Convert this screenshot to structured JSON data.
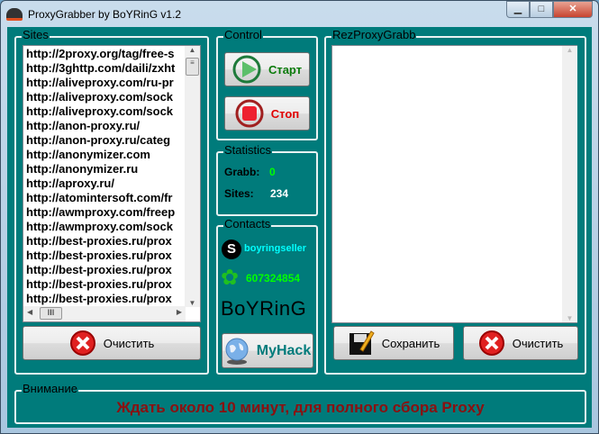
{
  "window": {
    "title": "ProxyGrabber by BoYRinG v1.2"
  },
  "sites": {
    "legend": "Sites",
    "items": [
      "http://2proxy.org/tag/free-s",
      "http://3ghttp.com/daili/zxht",
      "http://aliveproxy.com/ru-pr",
      "http://aliveproxy.com/sock",
      "http://aliveproxy.com/sock",
      "http://anon-proxy.ru/",
      "http://anon-proxy.ru/categ",
      "http://anonymizer.com",
      "http://anonymizer.ru",
      "http://aproxy.ru/",
      "http://atomintersoft.com/fr",
      "http://awmproxy.com/freep",
      "http://awmproxy.com/sock",
      "http://best-proxies.ru/prox",
      "http://best-proxies.ru/prox",
      "http://best-proxies.ru/prox",
      "http://best-proxies.ru/prox",
      "http://best-proxies.ru/prox"
    ],
    "clear_label": "Очистить"
  },
  "control": {
    "legend": "Control",
    "start_label": "Старт",
    "stop_label": "Стоп"
  },
  "statistics": {
    "legend": "Statistics",
    "grabb_label": "Grabb:",
    "grabb_value": "0",
    "sites_label": "Sites:",
    "sites_value": "234"
  },
  "contacts": {
    "legend": "Contacts",
    "skype": "boyringseller",
    "icq": "607324854",
    "logo": "BoYRinG",
    "myhack_label": "MyHack"
  },
  "result": {
    "legend": "RezProxyGrabb",
    "value": "",
    "save_label": "Сохранить",
    "clear_label": "Очистить"
  },
  "attention": {
    "legend": "Внимание",
    "message": "Ждать около 10 минут, для полного сбора Proxy"
  },
  "colors": {
    "background": "#007b7b",
    "message": "#8b1010",
    "grabb": "#00ff00",
    "skype": "#00ffff",
    "icq": "#00ff00"
  }
}
